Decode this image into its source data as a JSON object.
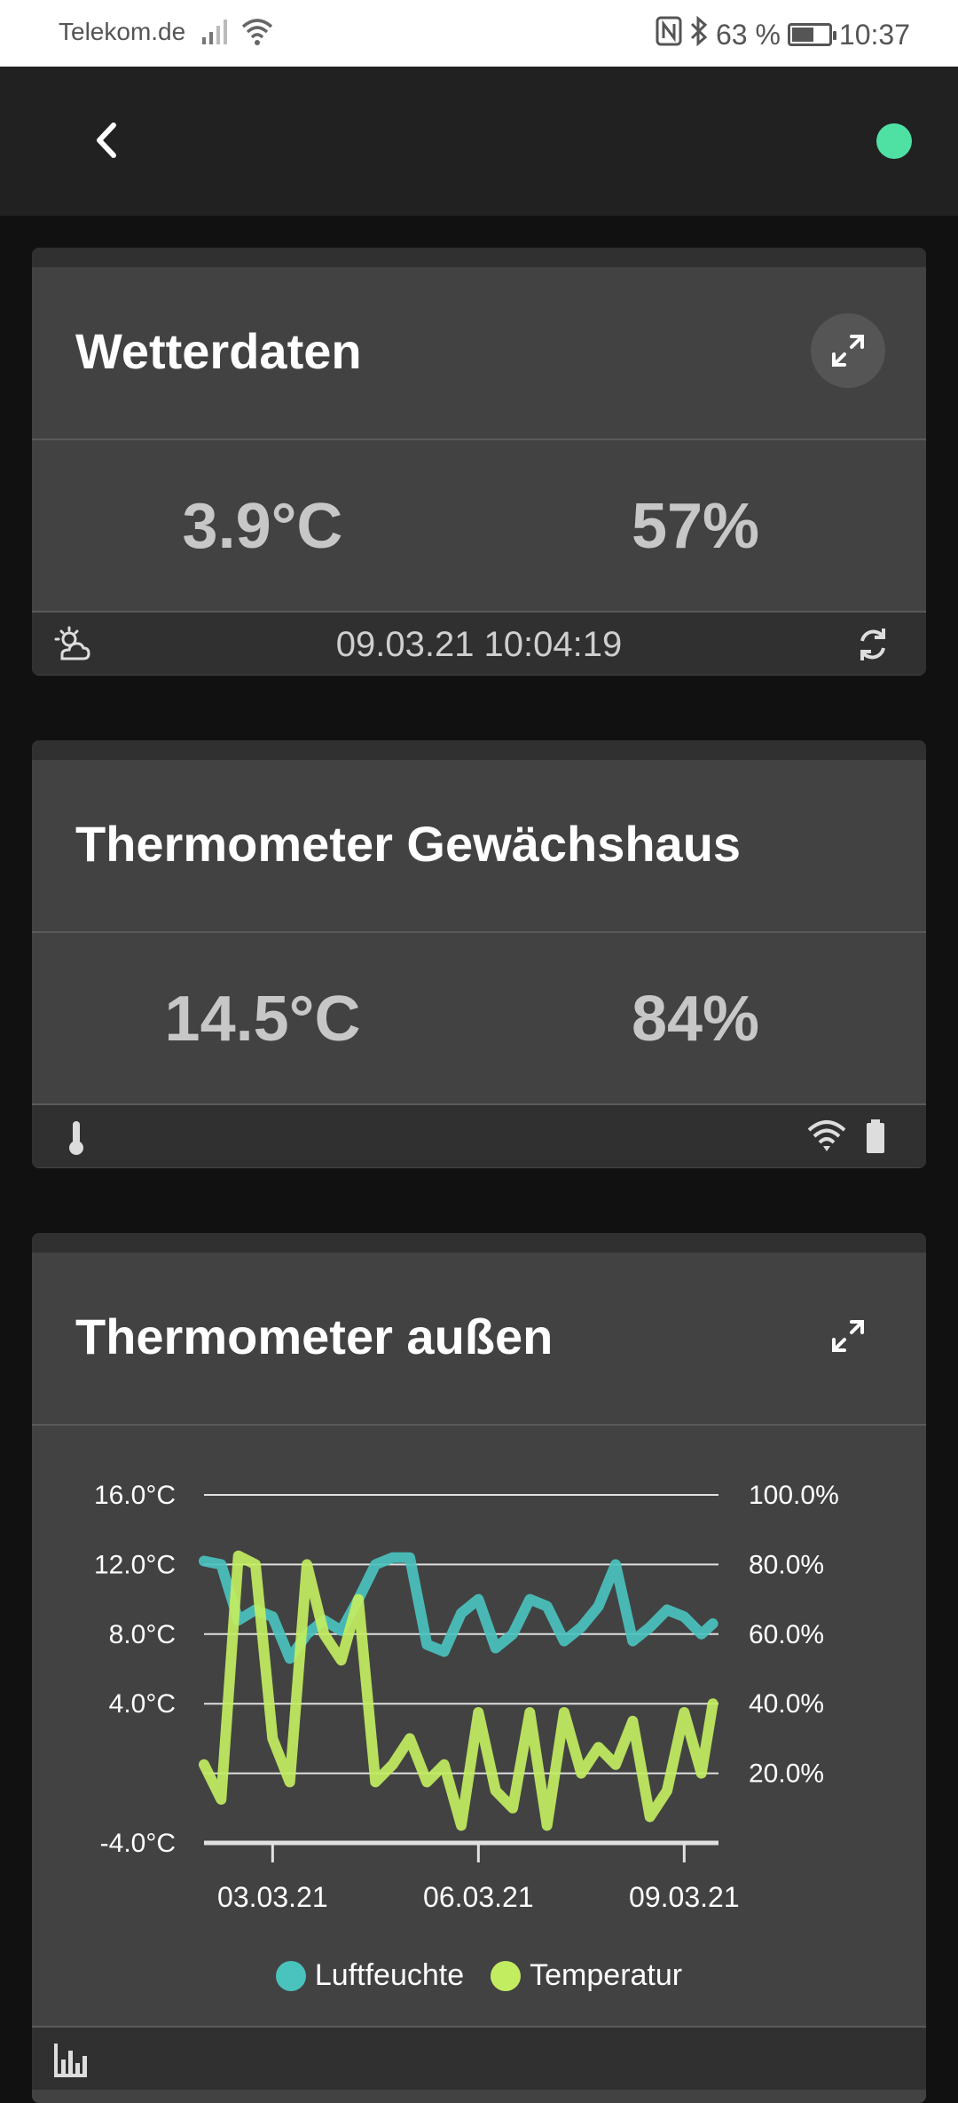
{
  "status_bar": {
    "carrier": "Telekom.de",
    "battery": "63 %",
    "battery_level": 0.63,
    "time": "10:37"
  },
  "app_bar": {
    "back_icon": "chevron-left-icon",
    "status_color": "#4fe0a4"
  },
  "cards": [
    {
      "title": "Wetterdaten",
      "value_left": "3.9°C",
      "value_right": "57%",
      "footer_time": "09.03.21 10:04:19",
      "footer_left_icon": "weather-partly-cloudy-icon",
      "footer_right_icon": "refresh-icon"
    },
    {
      "title": "Thermometer Gewächshaus",
      "value_left": "14.5°C",
      "value_right": "84%",
      "footer_left_icon": "thermometer-icon",
      "footer_right_icons": [
        "wifi-icon",
        "battery-icon"
      ]
    },
    {
      "title": "Thermometer außen",
      "footer_left_icon": "bar-chart-icon"
    }
  ],
  "chart_data": {
    "type": "line",
    "x_ticks": [
      "03.03.21",
      "06.03.21",
      "09.03.21"
    ],
    "y_left_ticks": [
      "16.0°C",
      "12.0°C",
      "8.0°C",
      "4.0°C",
      "-4.0°C"
    ],
    "y_right_ticks": [
      "100.0%",
      "80.0%",
      "60.0%",
      "40.0%",
      "20.0%"
    ],
    "y_left_range": [
      -4,
      16
    ],
    "y_right_range": [
      0,
      100
    ],
    "x_range": [
      "02.03.21",
      "09.03.21"
    ],
    "grid": true,
    "legend_position": "bottom",
    "series": [
      {
        "name": "Luftfeuchte",
        "axis": "right",
        "color": "#4ac2be",
        "x": [
          "02.03.21 00:00",
          "02.03.21 06:00",
          "02.03.21 12:00",
          "02.03.21 18:00",
          "03.03.21 00:00",
          "03.03.21 06:00",
          "03.03.21 12:00",
          "03.03.21 18:00",
          "04.03.21 00:00",
          "04.03.21 06:00",
          "04.03.21 12:00",
          "04.03.21 18:00",
          "05.03.21 00:00",
          "05.03.21 06:00",
          "05.03.21 12:00",
          "05.03.21 18:00",
          "06.03.21 00:00",
          "06.03.21 06:00",
          "06.03.21 12:00",
          "06.03.21 18:00",
          "07.03.21 00:00",
          "07.03.21 06:00",
          "07.03.21 12:00",
          "07.03.21 18:00",
          "08.03.21 00:00",
          "08.03.21 06:00",
          "08.03.21 12:00",
          "08.03.21 18:00",
          "09.03.21 00:00",
          "09.03.21 06:00",
          "09.03.21 10:00"
        ],
        "values": [
          81,
          80,
          64,
          67,
          65,
          53,
          60,
          64,
          61,
          70,
          80,
          82,
          82,
          57,
          55,
          66,
          70,
          56,
          60,
          70,
          68,
          58,
          62,
          68,
          80,
          58,
          62,
          67,
          65,
          60,
          63
        ]
      },
      {
        "name": "Temperatur",
        "axis": "left",
        "color": "#c2ed61",
        "x": [
          "02.03.21 00:00",
          "02.03.21 06:00",
          "02.03.21 12:00",
          "02.03.21 18:00",
          "03.03.21 00:00",
          "03.03.21 06:00",
          "03.03.21 12:00",
          "03.03.21 18:00",
          "04.03.21 00:00",
          "04.03.21 06:00",
          "04.03.21 12:00",
          "04.03.21 18:00",
          "05.03.21 00:00",
          "05.03.21 06:00",
          "05.03.21 12:00",
          "05.03.21 18:00",
          "06.03.21 00:00",
          "06.03.21 06:00",
          "06.03.21 12:00",
          "06.03.21 18:00",
          "07.03.21 00:00",
          "07.03.21 06:00",
          "07.03.21 12:00",
          "07.03.21 18:00",
          "08.03.21 00:00",
          "08.03.21 06:00",
          "08.03.21 12:00",
          "08.03.21 18:00",
          "09.03.21 00:00",
          "09.03.21 06:00",
          "09.03.21 10:00"
        ],
        "values": [
          0.5,
          -1.5,
          12.5,
          12.0,
          2.0,
          -0.5,
          12.0,
          8.0,
          6.5,
          10.0,
          -0.5,
          0.5,
          2.0,
          -0.5,
          0.5,
          -3.0,
          3.5,
          -1.0,
          -2.0,
          3.5,
          -3.0,
          3.5,
          0.0,
          1.5,
          0.5,
          3.0,
          -2.5,
          -1.0,
          3.5,
          0.0,
          4.0
        ]
      }
    ]
  }
}
